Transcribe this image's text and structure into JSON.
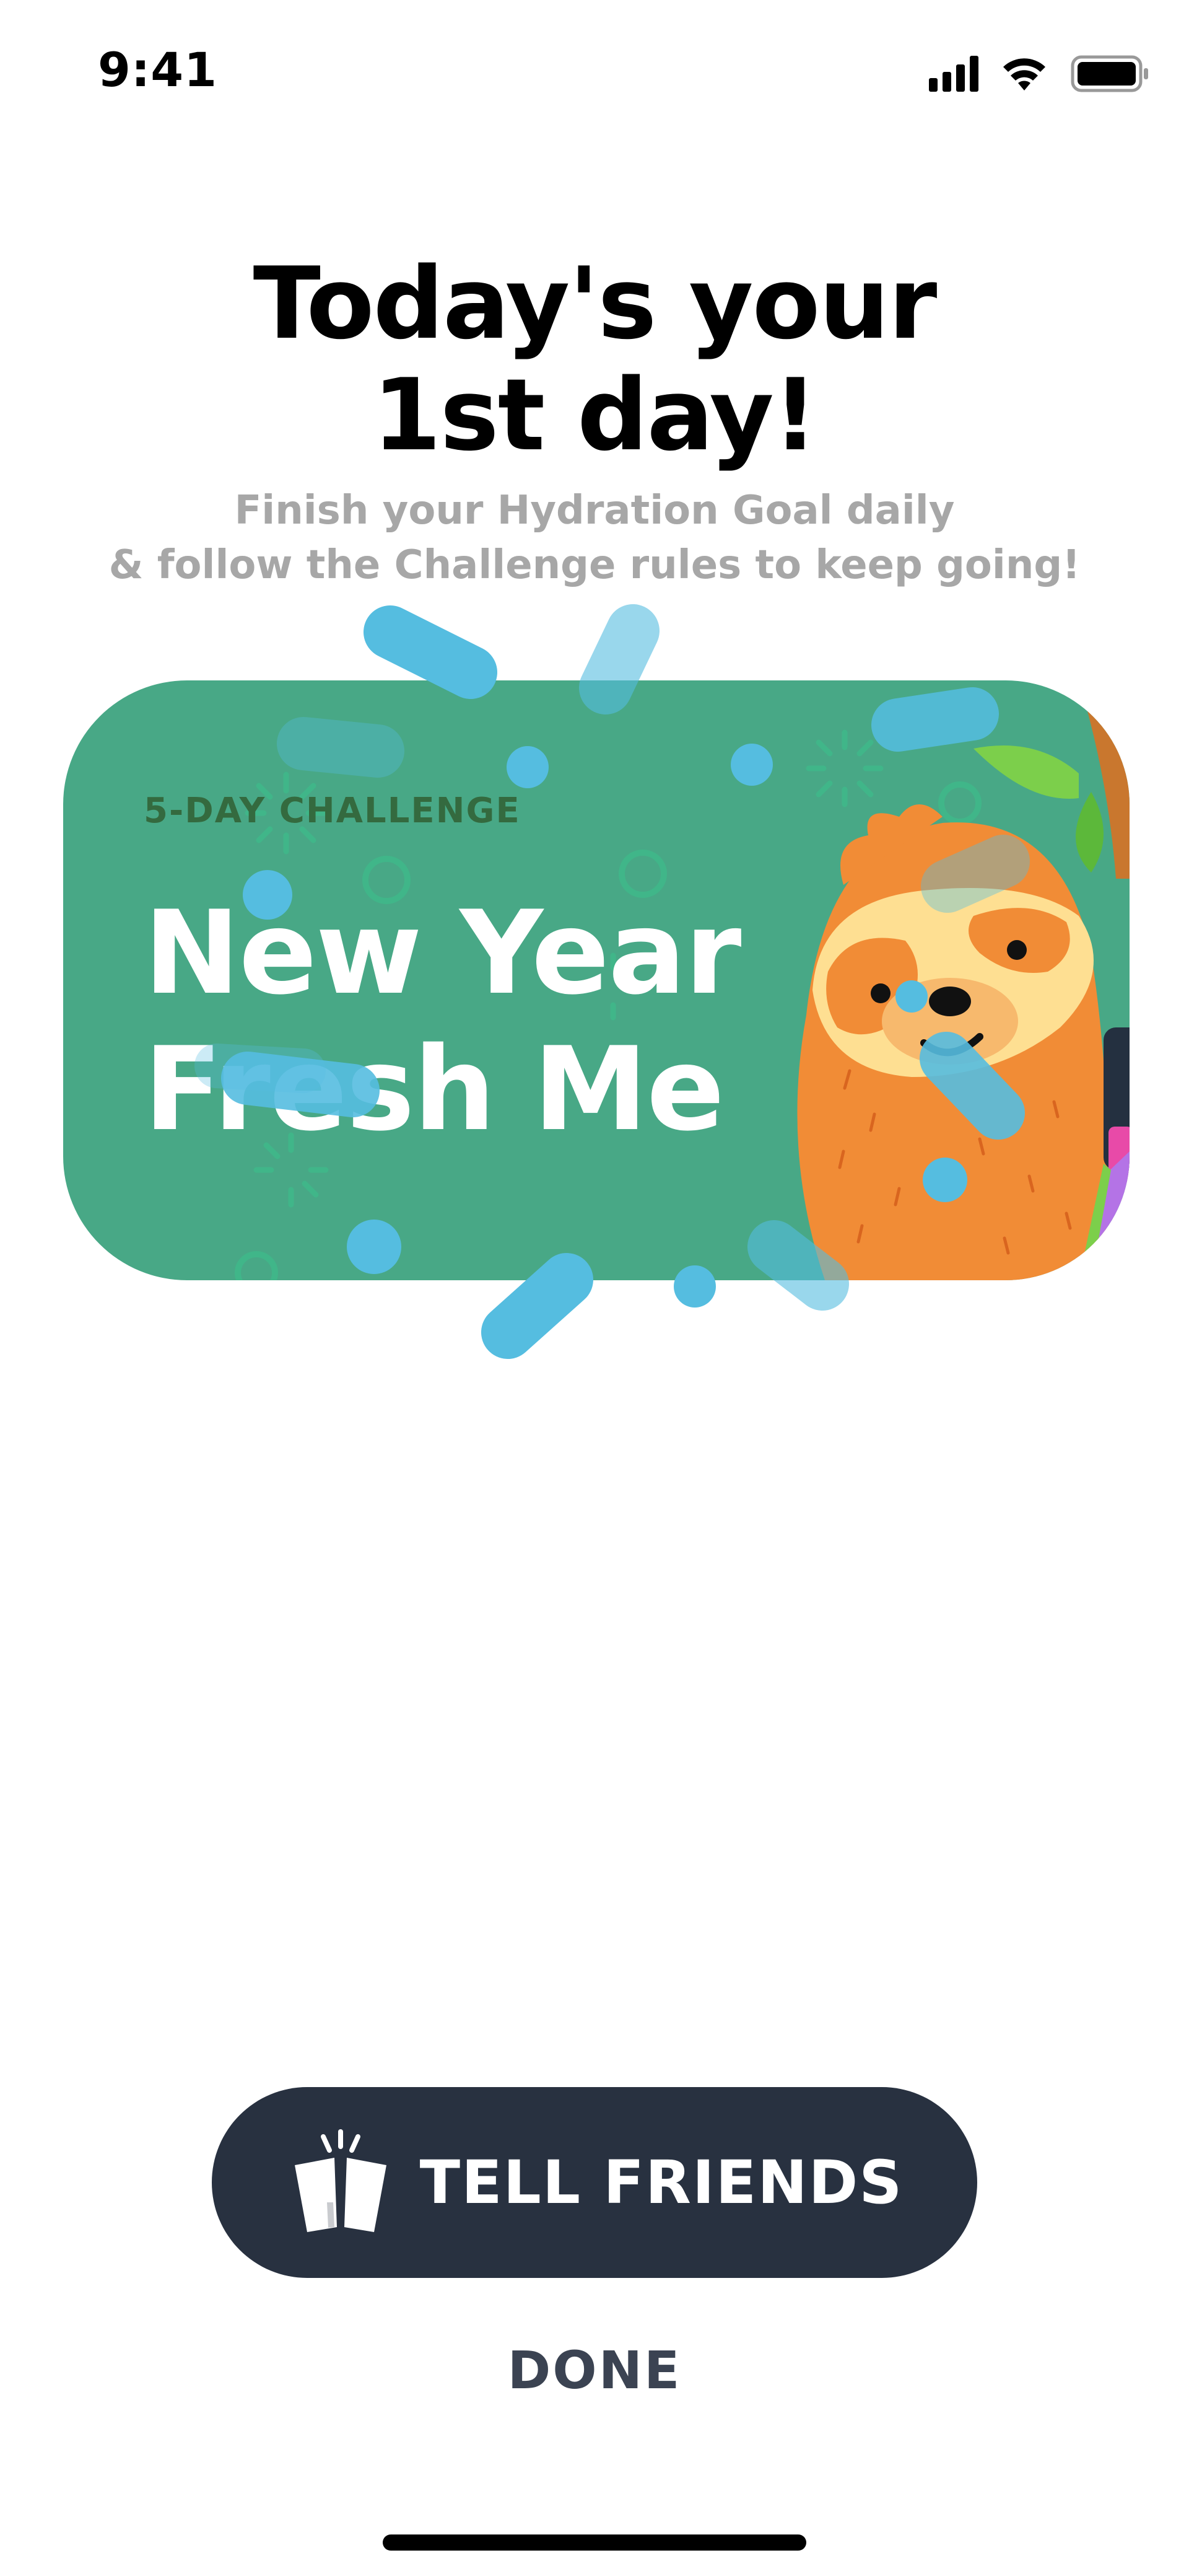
{
  "status_bar": {
    "time": "9:41"
  },
  "header": {
    "title_line1": "Today's your",
    "title_line2": "1st day!",
    "subtitle_line1": "Finish your Hydration Goal daily",
    "subtitle_line2": "& follow the Challenge rules to keep going!"
  },
  "challenge_card": {
    "kicker": "5-DAY CHALLENGE",
    "title_line1": "New Year",
    "title_line2": "Fresh Me",
    "illustration": "sloth-illustration",
    "colors": {
      "card": "#48a886",
      "confetti": "#55bde0",
      "kicker": "#346a3f"
    }
  },
  "actions": {
    "tell_friends_label": "TELL FRIENDS",
    "tell_friends_icon": "cheers-icon",
    "done_label": "DONE"
  },
  "colors": {
    "primary_button": "#283140",
    "subtitle": "#a7a7a7"
  }
}
